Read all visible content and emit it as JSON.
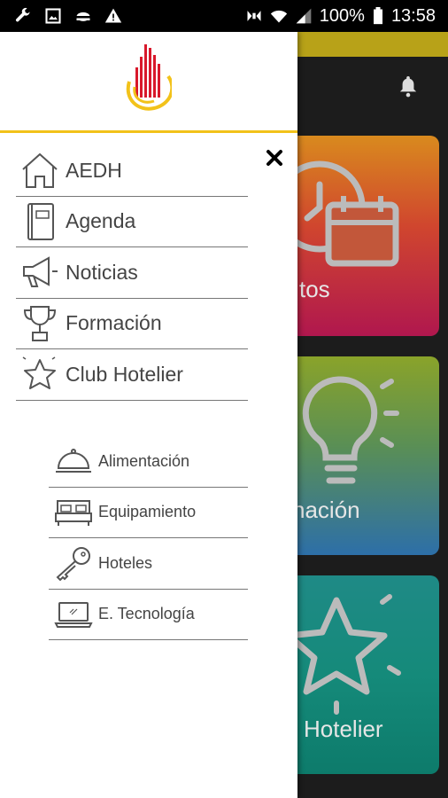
{
  "status_bar": {
    "battery": "100%",
    "time": "13:58",
    "left_icons": [
      "wrench-icon",
      "image-icon",
      "android-icon",
      "warning-icon"
    ],
    "right_icons": [
      "nfc-icon",
      "wifi-icon",
      "signal-icon",
      "battery-icon"
    ]
  },
  "drawer": {
    "logo": "aedh-logo",
    "close_icon": "close-icon",
    "menu_items": [
      {
        "label": "AEDH",
        "icon": "home-icon"
      },
      {
        "label": "Agenda",
        "icon": "agenda-book-icon"
      },
      {
        "label": "Noticias",
        "icon": "megaphone-icon"
      },
      {
        "label": "Formación",
        "icon": "trophy-icon"
      },
      {
        "label": "Club Hotelier",
        "icon": "star-icon"
      }
    ],
    "sub_items": [
      {
        "label": "Alimentación",
        "icon": "food-cloche-icon"
      },
      {
        "label": "Equipamiento",
        "icon": "bed-icon"
      },
      {
        "label": "Hoteles",
        "icon": "key-icon"
      },
      {
        "label": "E. Tecnología",
        "icon": "laptop-icon"
      }
    ],
    "accent_color": "#f2c21a"
  },
  "background": {
    "topbar_color": "#b8a218",
    "cards": [
      {
        "label": "tos",
        "icon": "clock-calendar-icon"
      },
      {
        "label": "nación",
        "icon": "lightbulb-icon"
      },
      {
        "label": "Hotelier",
        "icon": "star-icon"
      }
    ]
  }
}
